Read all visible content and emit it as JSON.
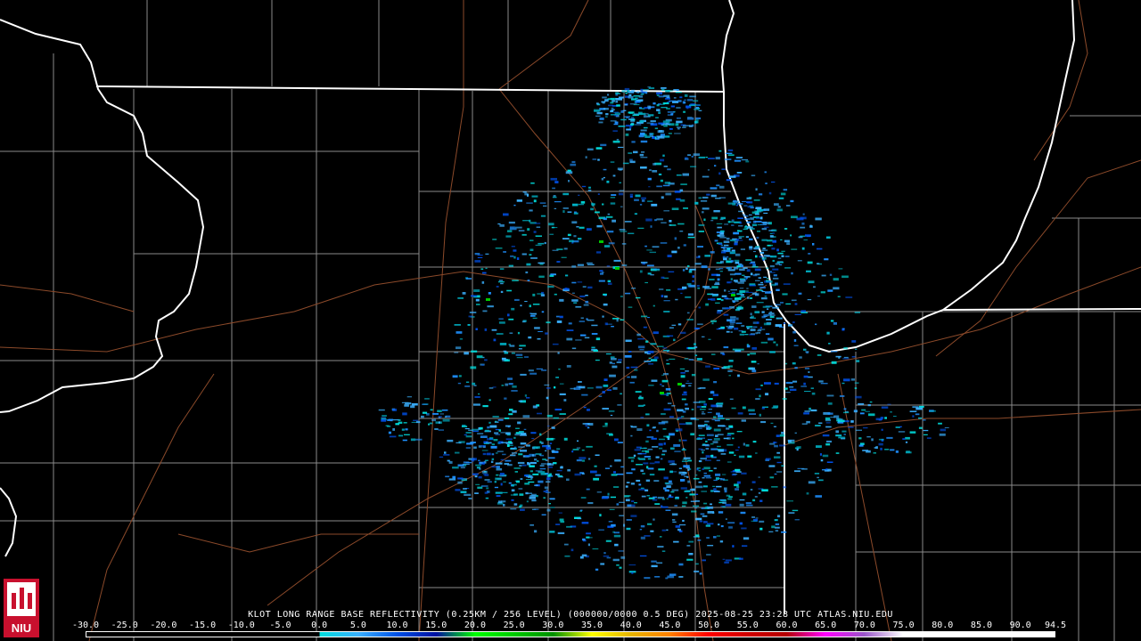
{
  "product": {
    "caption": "KLOT LONG RANGE BASE REFLECTIVITY (0.25KM / 256 LEVEL) (000000/0000 0.5 DEG) 2025-08-25 23:28 UTC  ATLAS.NIU.EDU"
  },
  "logo": {
    "text": "NIU",
    "icon": "niu-tower-logo-icon"
  },
  "legend": {
    "ticks": [
      "-30.0",
      "-25.0",
      "-20.0",
      "-15.0",
      "-10.0",
      "-5.0",
      "0.0",
      "5.0",
      "10.0",
      "15.0",
      "20.0",
      "25.0",
      "30.0",
      "35.0",
      "40.0",
      "45.0",
      "50.0",
      "55.0",
      "60.0",
      "65.0",
      "70.0",
      "75.0",
      "80.0",
      "85.0",
      "90.0",
      "94.5"
    ],
    "range": [
      -30.0,
      94.5
    ],
    "colors": {
      "below_zero": "#000000",
      "stops": [
        [
          0,
          "#00dede"
        ],
        [
          5,
          "#3ab0ff"
        ],
        [
          10,
          "#0050e6"
        ],
        [
          15,
          "#0010a0"
        ],
        [
          20,
          "#00ff00"
        ],
        [
          25,
          "#00c800"
        ],
        [
          30,
          "#009000"
        ],
        [
          35,
          "#ffff00"
        ],
        [
          40,
          "#e6b400"
        ],
        [
          45,
          "#ff8000"
        ],
        [
          50,
          "#ff0000"
        ],
        [
          55,
          "#d00000"
        ],
        [
          60,
          "#b40000"
        ],
        [
          65,
          "#ff00ff"
        ],
        [
          70,
          "#9955c9"
        ],
        [
          75,
          "#ffffff"
        ],
        [
          94.5,
          "#ffffff"
        ]
      ]
    }
  },
  "map_colors": {
    "background": "#000000",
    "state_borders": "#ffffff",
    "county_borders": "#8a8a8a",
    "highways": "#8c4a2a"
  }
}
